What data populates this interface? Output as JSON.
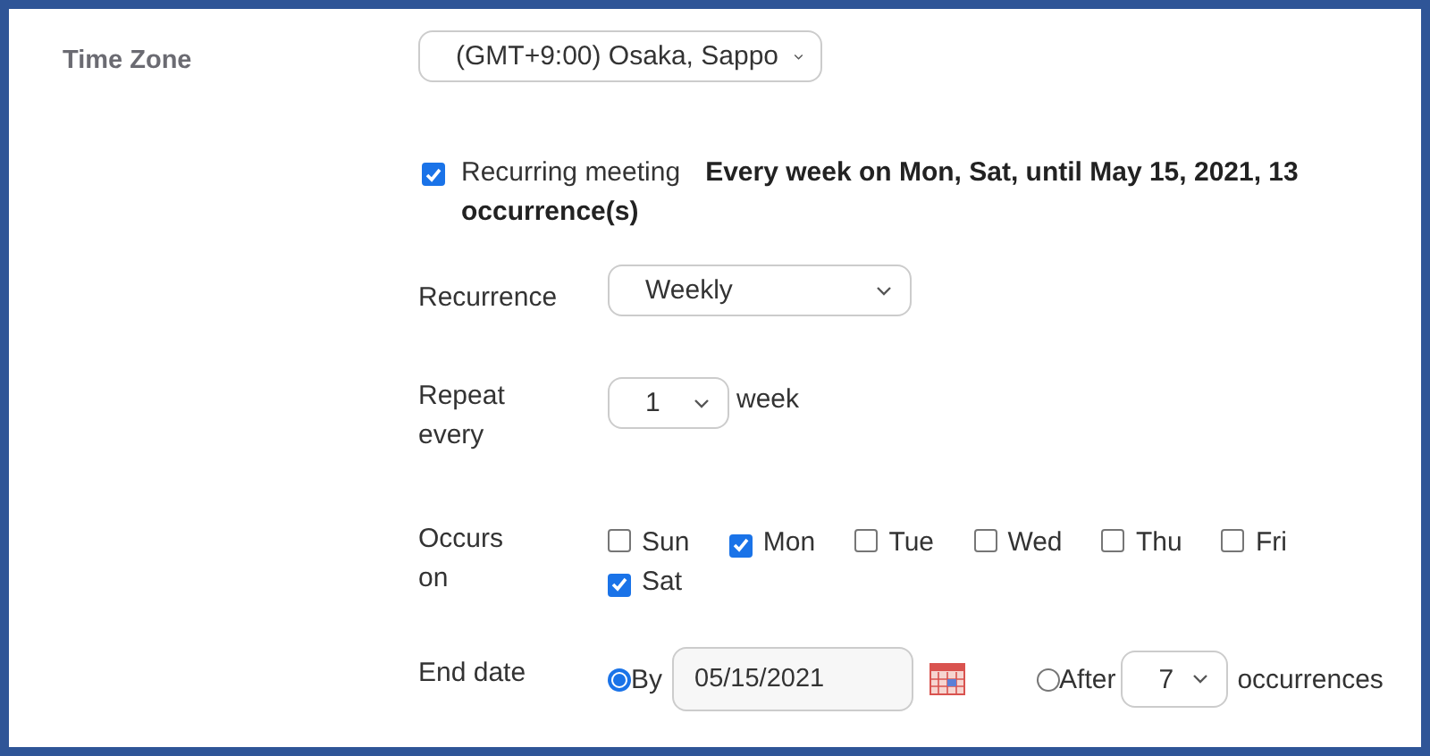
{
  "time_zone": {
    "label": "Time Zone",
    "value": "(GMT+9:00) Osaka, Sappo"
  },
  "recurring": {
    "label": "Recurring meeting",
    "checked": true,
    "summary": "Every week on Mon, Sat, until May 15, 2021, 13 occurrence(s)"
  },
  "recurrence": {
    "label": "Recurrence",
    "value": "Weekly"
  },
  "repeat": {
    "label": "Repeat every",
    "value": "1",
    "unit": "week"
  },
  "occurs": {
    "label": "Occurs on",
    "days": [
      {
        "label": "Sun",
        "checked": false
      },
      {
        "label": "Mon",
        "checked": true
      },
      {
        "label": "Tue",
        "checked": false
      },
      {
        "label": "Wed",
        "checked": false
      },
      {
        "label": "Thu",
        "checked": false
      },
      {
        "label": "Fri",
        "checked": false
      },
      {
        "label": "Sat",
        "checked": true
      }
    ]
  },
  "end_date": {
    "label": "End date",
    "options": [
      {
        "kind": "date",
        "label": "By",
        "selected": true,
        "value": "05/15/2021"
      },
      {
        "kind": "count",
        "label": "After",
        "selected": false,
        "value": "7",
        "unit": "occurrences"
      }
    ]
  }
}
